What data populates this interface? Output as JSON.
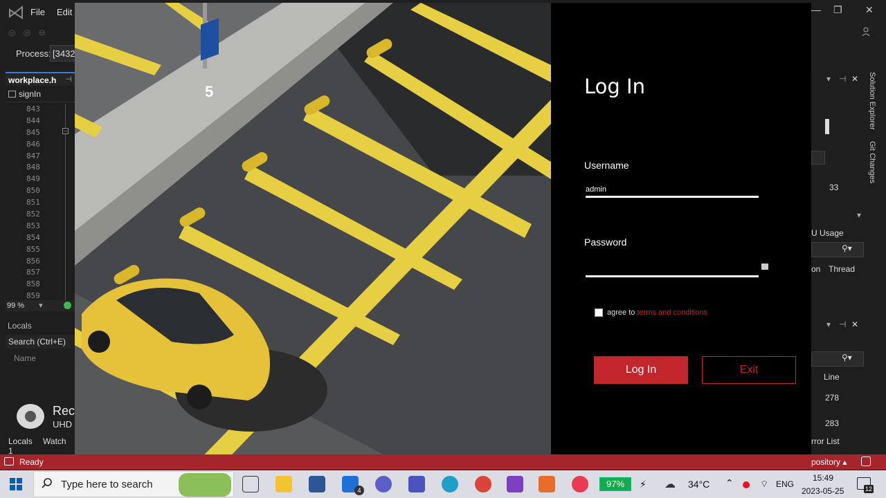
{
  "vs": {
    "menu": [
      "File",
      "Edit"
    ],
    "process_label": "Process:",
    "process_value": "[3432",
    "editor_tab": "workplace.h",
    "nav_member": "signIn",
    "line_numbers": [
      "843",
      "844",
      "845",
      "846",
      "847",
      "848",
      "849",
      "850",
      "851",
      "852",
      "853",
      "854",
      "855",
      "856",
      "857",
      "858",
      "859"
    ],
    "zoom": "99 %",
    "locals_title": "Locals",
    "locals_search": "Search (Ctrl+E)",
    "locals_col_name": "Name",
    "bottom_tabs": [
      "Locals",
      "Watch 1"
    ],
    "status": "Ready",
    "status_repo": "pository",
    "right_panel": {
      "vtab_solution": "Solution Explorer",
      "vtab_git": "Git Changes",
      "value_33": "33",
      "u_usage": "U Usage",
      "col_on": "on",
      "col_thread": "Thread",
      "col_line": "Line",
      "line_1": "278",
      "line_2": "283",
      "error_list": "rror List"
    }
  },
  "recorder": {
    "title": "RecForth",
    "subtitle": "UHD Screen Recorder"
  },
  "login": {
    "title": "Log In",
    "username_label": "Username",
    "username_value": "admin",
    "password_label": "Password",
    "password_value": "",
    "agree_text": "agree to",
    "terms_link": "terms and conditions",
    "login_button": "Log In",
    "exit_button": "Exit",
    "accent": "#c0262c"
  },
  "taskbar": {
    "search_placeholder": "Type here to search",
    "mail_badge": "4",
    "battery": "97%",
    "temperature": "34°C",
    "language": "ENG",
    "time": "15:49",
    "date": "2023-05-25",
    "notifications": "12"
  }
}
